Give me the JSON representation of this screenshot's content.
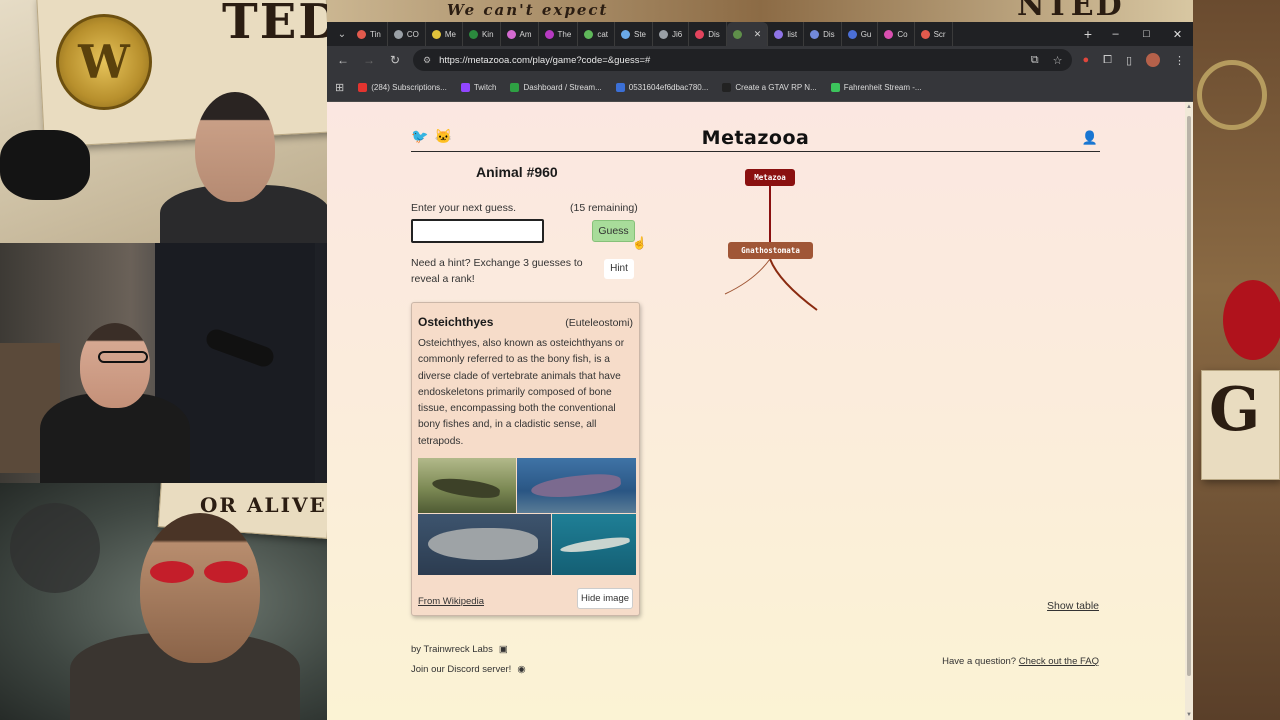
{
  "overlay": {
    "poster_left_text": "TED",
    "poster_top_text": "We can't expect",
    "poster_right_text": "NTED",
    "poster_alive_text": "OR ALIVE",
    "poster_side_text": "G",
    "medallion_letter": "W"
  },
  "browser": {
    "tabs": [
      {
        "label": "Tin",
        "color": "#e25a4d"
      },
      {
        "label": "CO",
        "color": "#9aa0a6"
      },
      {
        "label": "Me",
        "color": "#e0c23b"
      },
      {
        "label": "Kin",
        "color": "#2b8a3e"
      },
      {
        "label": "Am",
        "color": "#d46ad1"
      },
      {
        "label": "The",
        "color": "#b73ac2"
      },
      {
        "label": "cat",
        "color": "#5fb85a"
      },
      {
        "label": "Ste",
        "color": "#6aa9e8"
      },
      {
        "label": "Ji6",
        "color": "#9aa0a6"
      },
      {
        "label": "Dis",
        "color": "#e3445d"
      },
      {
        "label": "",
        "color": "#5f8f4a",
        "active": true
      },
      {
        "label": "list",
        "color": "#8f74e6"
      },
      {
        "label": "Dis",
        "color": "#7289da"
      },
      {
        "label": "Gu",
        "color": "#4b6fd6"
      },
      {
        "label": "Co",
        "color": "#d94fb0"
      },
      {
        "label": "Scr",
        "color": "#e25a4d"
      }
    ],
    "new_tab": "+",
    "window_controls": {
      "minimize": "–",
      "maximize": "□",
      "close": "✕"
    },
    "url": "https://metazooa.com/play/game?code=&guess=#",
    "bookmarks": [
      {
        "label": "(284) Subscriptions...",
        "color": "#e3342f"
      },
      {
        "label": "Twitch",
        "color": "#9146ff"
      },
      {
        "label": "Dashboard / Stream...",
        "color": "#2ea043"
      },
      {
        "label": "0531604ef6dbac780...",
        "color": "#3b6fd6"
      },
      {
        "label": "Create a GTAV RP N...",
        "color": "#222222"
      },
      {
        "label": "Fahrenheit Stream -...",
        "color": "#3cc45c"
      }
    ]
  },
  "page": {
    "site_title": "Metazooa",
    "animal_title": "Animal #960",
    "guess_prompt": "Enter your next guess.",
    "remaining": "(15 remaining)",
    "guess_placeholder": "",
    "guess_button": "Guess",
    "hint_text": "Need a hint? Exchange 3 guesses to reveal a rank!",
    "hint_button": "Hint",
    "card": {
      "title": "Osteichthyes",
      "clade": "(Euteleostomi)",
      "description": "Osteichthyes, also known as osteichthyans or commonly referred to as the bony fish, is a diverse clade of vertebrate animals that have endoskeletons primarily composed of bone tissue, encompassing both the conventional bony fishes and, in a cladistic sense, all tetrapods.",
      "wiki_link": "From Wikipedia",
      "hide_button": "Hide image"
    },
    "tree": {
      "root": "Metazoa",
      "child": "Gnathostomata",
      "root_color": "#8a1010",
      "child_color": "#a05636"
    },
    "footer": {
      "by": "by Trainwreck Labs",
      "discord": "Join our Discord server!",
      "show_table": "Show table",
      "faq_prefix": "Have a question?",
      "faq_link": "Check out the FAQ"
    }
  }
}
